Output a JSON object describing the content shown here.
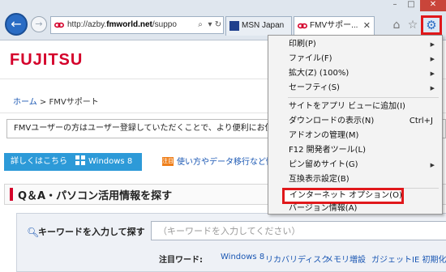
{
  "browser": {
    "address_url_host": "azby.",
    "address_url_bold": "fmworld.net",
    "address_url_rest": "/suppo",
    "tabs": [
      {
        "label": "MSN Japan"
      },
      {
        "label": "FMVサポー..."
      }
    ],
    "window_controls": {
      "minimize": "–",
      "maximize": "□",
      "close": "✕"
    }
  },
  "page": {
    "logo": "FUJITSU",
    "breadcrumb": {
      "home": "ホーム",
      "separator": ">",
      "current": "FMVサポート"
    },
    "notice": "FMVユーザーの方はユーザー登録していただくことで、より便利にお使いいただけます。",
    "detail_button": {
      "label": "詳しくはこちら",
      "os": "Windows 8"
    },
    "note_badge": "注目",
    "note_link": "使い方やデータ移行など情",
    "section_title": "Q＆A・パソコン活用情報を探す",
    "search": {
      "label": "キーワードを入力して探す",
      "placeholder": "（キーワードを入力してください）"
    },
    "popular": {
      "label": "注目ワード:",
      "items": [
        "Windows 8",
        "リカバリディスク",
        "メモリ増設",
        "ガジェット",
        "IE 初期化"
      ]
    }
  },
  "menu": {
    "items": [
      {
        "label": "印刷(P)",
        "arrow": "▶"
      },
      {
        "label": "ファイル(F)",
        "arrow": "▶"
      },
      {
        "label": "拡大(Z) (100%)",
        "arrow": "▶"
      },
      {
        "label": "セーフティ(S)",
        "arrow": "▶"
      },
      {
        "label": "サイトをアプリ ビューに追加(I)"
      },
      {
        "label": "ダウンロードの表示(N)",
        "shortcut": "Ctrl+J"
      },
      {
        "label": "アドオンの管理(M)"
      },
      {
        "label": "F12 開発者ツール(L)"
      },
      {
        "label": "ピン留めサイト(G)",
        "arrow": "▶"
      },
      {
        "label": "互換表示設定(B)"
      },
      {
        "label": "インターネット オプション(O)"
      },
      {
        "label": "バージョン情報(A)"
      }
    ]
  },
  "colors": {
    "highlight_border": "#e0181b",
    "brand_red": "#d4002a",
    "link_blue": "#1a57b3",
    "detail_button_bg": "#2d9ad8"
  }
}
